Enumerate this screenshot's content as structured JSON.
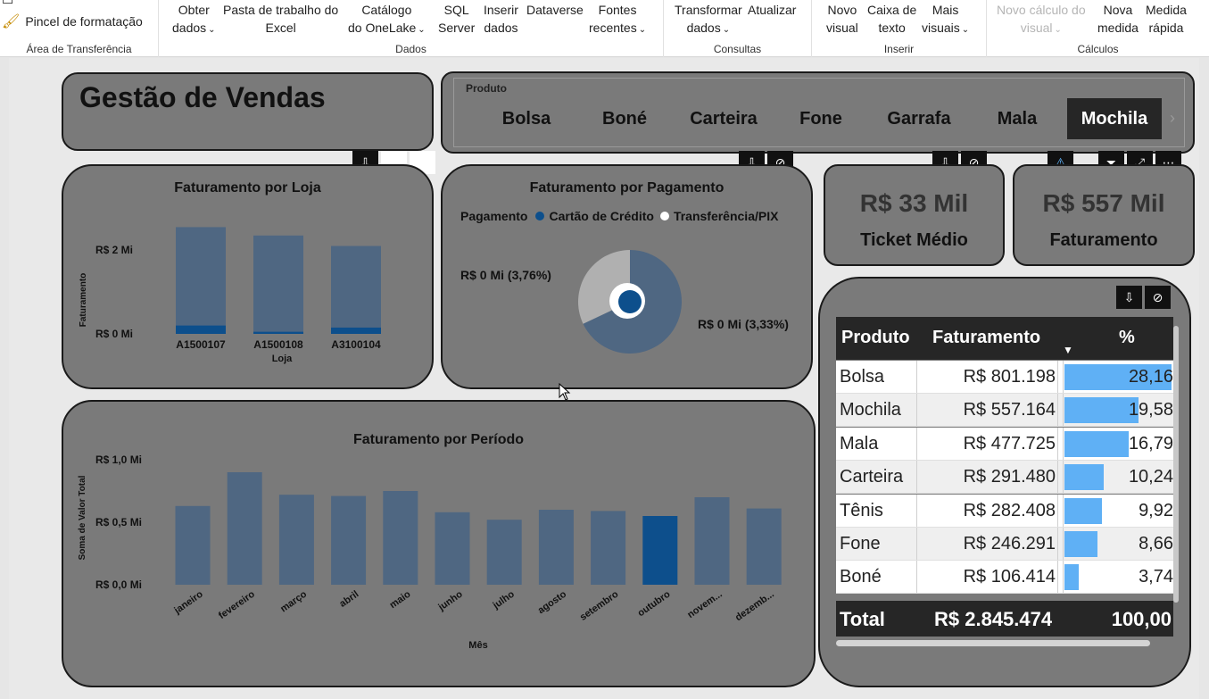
{
  "ribbon": {
    "clipboard": {
      "brush_label": "Pincel de formatação",
      "group_label": "Área de Transferência"
    },
    "dados": {
      "group_label": "Dados",
      "obter": [
        "Obter",
        "dados"
      ],
      "pasta": [
        "Pasta de trabalho do",
        "Excel"
      ],
      "catalogo": [
        "Catálogo",
        "do OneLake"
      ],
      "sql": [
        "SQL",
        "Server"
      ],
      "inserir": [
        "Inserir",
        "dados"
      ],
      "dataverse": "Dataverse",
      "fontes": [
        "Fontes",
        "recentes"
      ]
    },
    "consultas": {
      "group_label": "Consultas",
      "transformar": [
        "Transformar",
        "dados"
      ],
      "atualizar": "Atualizar"
    },
    "inserir": {
      "group_label": "Inserir",
      "novo_visual": [
        "Novo",
        "visual"
      ],
      "caixa_texto": [
        "Caixa de",
        "texto"
      ],
      "mais_visuais": [
        "Mais",
        "visuais"
      ]
    },
    "calculos": {
      "group_label": "Cálculos",
      "novo_calculo": [
        "Novo cálculo do",
        "visual"
      ],
      "nova_medida": [
        "Nova",
        "medida"
      ],
      "medida_rapida": [
        "Medida",
        "rápida"
      ]
    }
  },
  "report": {
    "title": "Gestão de Vendas",
    "slicer": {
      "label": "Produto",
      "items": [
        "Bolsa",
        "Boné",
        "Carteira",
        "Fone",
        "Garrafa",
        "Mala",
        "Mochila"
      ],
      "selected": "Mochila"
    },
    "loja_chart": {
      "title": "Faturamento por Loja",
      "ylabel": "Faturamento",
      "xlabel": "Loja"
    },
    "pagamento_chart": {
      "title": "Faturamento por Pagamento",
      "legend_title": "Pagamento",
      "legend_items": [
        "Cartão de Crédito",
        "Transferência/PIX"
      ],
      "label_left": "R$ 0 Mi (3,76%)",
      "label_right": "R$ 0 Mi (3,33%)"
    },
    "kpi_ticket": {
      "value": "R$ 33 Mil",
      "label": "Ticket Médio"
    },
    "kpi_fat": {
      "value": "R$ 557 Mil",
      "label": "Faturamento"
    },
    "periodo_chart": {
      "title": "Faturamento por Período",
      "ylabel": "Soma de Valor Total",
      "xlabel": "Mês"
    },
    "table": {
      "headers": [
        "Produto",
        "Faturamento",
        "%"
      ],
      "rows": [
        {
          "produto": "Bolsa",
          "fat": "R$ 801.198",
          "pct": "28,16",
          "pct_value": 28.16
        },
        {
          "produto": "Mochila",
          "fat": "R$ 557.164",
          "pct": "19,58",
          "pct_value": 19.58
        },
        {
          "produto": "Mala",
          "fat": "R$ 477.725",
          "pct": "16,79",
          "pct_value": 16.79
        },
        {
          "produto": "Carteira",
          "fat": "R$ 291.480",
          "pct": "10,24",
          "pct_value": 10.24
        },
        {
          "produto": "Tênis",
          "fat": "R$ 282.408",
          "pct": "9,92",
          "pct_value": 9.92
        },
        {
          "produto": "Fone",
          "fat": "R$ 246.291",
          "pct": "8,66",
          "pct_value": 8.66
        },
        {
          "produto": "Boné",
          "fat": "R$ 106.414",
          "pct": "3,74",
          "pct_value": 3.74
        }
      ],
      "total": {
        "label": "Total",
        "fat": "R$ 2.845.474",
        "pct": "100,00"
      }
    },
    "colors": {
      "bar": "#4f6782",
      "highlight": "#0d4f8c",
      "table_bar": "#5fb0f5",
      "pie_main": "#4f6782",
      "pie_other": "#b0b0b0"
    }
  },
  "chart_data": [
    {
      "type": "bar",
      "title": "Faturamento por Loja",
      "xlabel": "Loja",
      "ylabel": "Faturamento",
      "categories": [
        "A1500107",
        "A1500108",
        "A3100104"
      ],
      "series": [
        {
          "name": "Total",
          "values": [
            2.55,
            2.35,
            2.1
          ]
        },
        {
          "name": "Mochila",
          "values": [
            0.2,
            0.05,
            0.15
          ]
        }
      ],
      "tick_labels": [
        "R$ 0 Mi",
        "R$ 2 Mi"
      ],
      "ylim": [
        0,
        2.9
      ]
    },
    {
      "type": "pie",
      "title": "Faturamento por Pagamento",
      "categories": [
        "Cartão de Crédito",
        "Transferência/PIX"
      ],
      "values": [
        3.76,
        3.33
      ],
      "shares": [
        0.68,
        0.32
      ]
    },
    {
      "type": "bar",
      "title": "Faturamento por Período",
      "xlabel": "Mês",
      "ylabel": "Soma de Valor Total",
      "categories": [
        "janeiro",
        "fevereiro",
        "março",
        "abril",
        "maio",
        "junho",
        "julho",
        "agosto",
        "setembro",
        "outubro",
        "novem...",
        "dezemb..."
      ],
      "values": [
        0.63,
        0.9,
        0.72,
        0.71,
        0.75,
        0.58,
        0.52,
        0.6,
        0.59,
        0.55,
        0.7,
        0.61
      ],
      "highlight_index": 9,
      "tick_labels": [
        "R$ 0,0 Mi",
        "R$ 0,5 Mi",
        "R$ 1,0 Mi"
      ],
      "ylim": [
        0,
        1.0
      ]
    }
  ]
}
